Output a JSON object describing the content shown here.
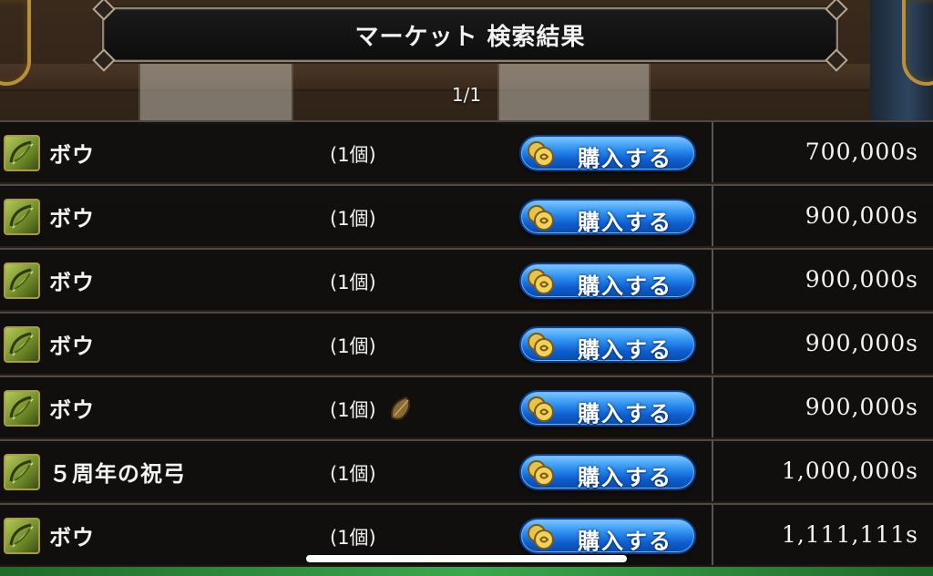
{
  "header": {
    "title": "マーケット 検索結果",
    "page": "1/1"
  },
  "listings": [
    {
      "name": "ボウ",
      "qty": "(1個)",
      "button": "購入する",
      "price": "700,000s",
      "extra_icon": false
    },
    {
      "name": "ボウ",
      "qty": "(1個)",
      "button": "購入する",
      "price": "900,000s",
      "extra_icon": false
    },
    {
      "name": "ボウ",
      "qty": "(1個)",
      "button": "購入する",
      "price": "900,000s",
      "extra_icon": false
    },
    {
      "name": "ボウ",
      "qty": "(1個)",
      "button": "購入する",
      "price": "900,000s",
      "extra_icon": false
    },
    {
      "name": "ボウ",
      "qty": "(1個)",
      "button": "購入する",
      "price": "900,000s",
      "extra_icon": true
    },
    {
      "name": "５周年の祝弓",
      "qty": "(1個)",
      "button": "購入する",
      "price": "1,000,000s",
      "extra_icon": false
    },
    {
      "name": "ボウ",
      "qty": "(1個)",
      "button": "購入する",
      "price": "1,111,111s",
      "extra_icon": false
    }
  ],
  "icons": {
    "item": "bow-icon",
    "button": "coin-icon",
    "extra": "seed-icon"
  },
  "colors": {
    "button_blue": "#2b8ff0",
    "row_bg": "#0e0e0e",
    "divider": "#4d4a45",
    "frame_gold": "#b8903d"
  }
}
